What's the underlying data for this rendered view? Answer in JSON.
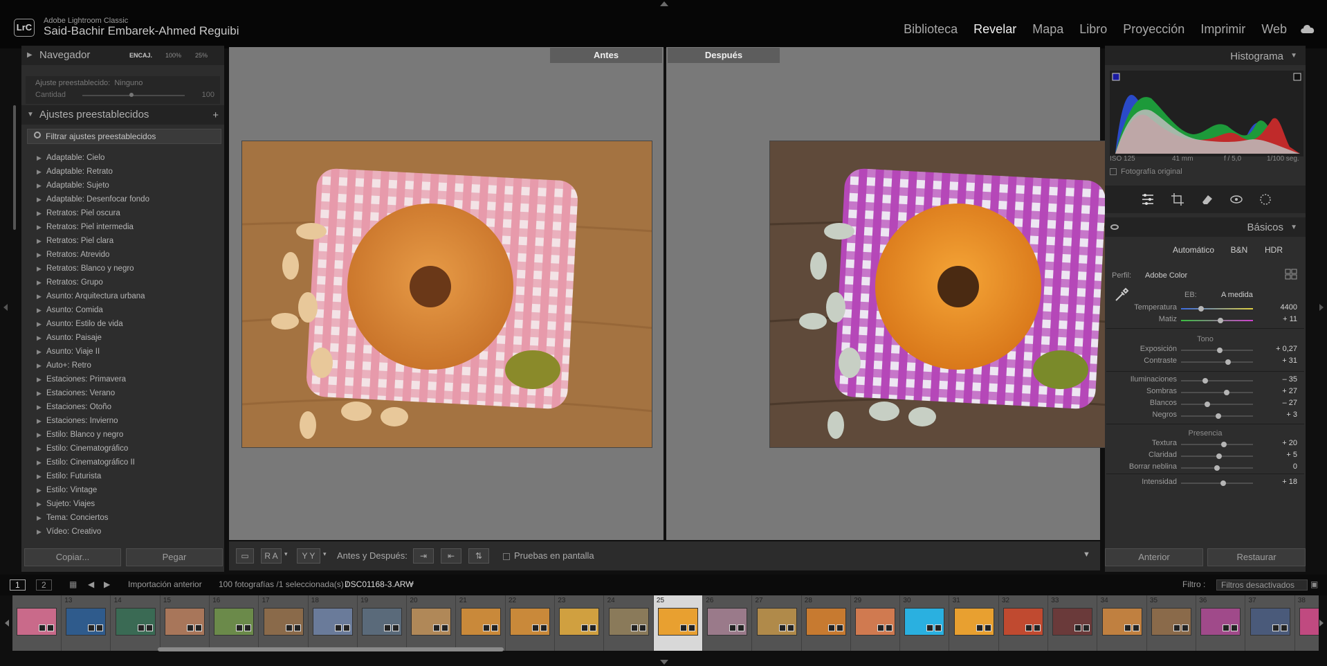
{
  "app": {
    "product": "Adobe Lightroom Classic",
    "logo": "LrC",
    "user": "Said-Bachir Embarek-Ahmed Reguibi"
  },
  "modules": [
    "Biblioteca",
    "Revelar",
    "Mapa",
    "Libro",
    "Proyección",
    "Imprimir",
    "Web"
  ],
  "active_module": "Revelar",
  "left": {
    "navigator": {
      "title": "Navegador",
      "zoom_fit": "ENCAJ.",
      "zoom_100": "100%",
      "zoom_25": "25%"
    },
    "preset_box": {
      "label": "Ajuste preestablecido:",
      "value": "Ninguno",
      "amount_label": "Cantidad",
      "amount_value": "100",
      "amount_fraction": 0.8
    },
    "presets": {
      "title": "Ajustes preestablecidos",
      "filter_placeholder": "Filtrar ajustes preestablecidos",
      "items": [
        "Adaptable: Cielo",
        "Adaptable: Retrato",
        "Adaptable: Sujeto",
        "Adaptable: Desenfocar fondo",
        "Retratos: Piel oscura",
        "Retratos: Piel intermedia",
        "Retratos: Piel clara",
        "Retratos: Atrevido",
        "Retratos: Blanco y negro",
        "Retratos: Grupo",
        "Asunto: Arquitectura urbana",
        "Asunto: Comida",
        "Asunto: Estilo de vida",
        "Asunto: Paisaje",
        "Asunto: Viaje II",
        "Auto+: Retro",
        "Estaciones: Primavera",
        "Estaciones: Verano",
        "Estaciones: Otoño",
        "Estaciones: Invierno",
        "Estilo: Blanco y negro",
        "Estilo: Cinematográfico",
        "Estilo: Cinematográfico II",
        "Estilo: Futurista",
        "Estilo: Vintage",
        "Sujeto: Viajes",
        "Tema: Conciertos",
        "Vídeo: Creativo"
      ]
    },
    "buttons": {
      "copy": "Copiar...",
      "paste": "Pegar"
    }
  },
  "center": {
    "before_label": "Antes",
    "after_label": "Después"
  },
  "toolbar": {
    "mode_ra": "R A",
    "mode_yy": "Y Y",
    "before_after": "Antes y Después:",
    "proof": "Pruebas en pantalla"
  },
  "right": {
    "histogram": {
      "title": "Histograma",
      "iso": "ISO 125",
      "focal": "41 mm",
      "aperture": "f / 5,0",
      "shutter": "1/100 seg.",
      "original": "Fotografía original"
    },
    "basic": {
      "title": "Básicos",
      "treatments": [
        "Automático",
        "B&N",
        "HDR"
      ],
      "profile_label": "Perfil:",
      "profile_value": "Adobe Color",
      "wb_label": "EB:",
      "wb_value": "A medida",
      "wb_sliders": [
        {
          "label": "Temperatura",
          "value": "4400",
          "pos": 0.28
        },
        {
          "label": "Matiz",
          "value": "+ 11",
          "pos": 0.55
        }
      ],
      "tone_label": "Tono",
      "tone_sliders": [
        {
          "label": "Exposición",
          "value": "+ 0,27",
          "pos": 0.54
        },
        {
          "label": "Contraste",
          "value": "+ 31",
          "pos": 0.65
        }
      ],
      "tone2_sliders": [
        {
          "label": "Iluminaciones",
          "value": "– 35",
          "pos": 0.34
        },
        {
          "label": "Sombras",
          "value": "+ 27",
          "pos": 0.63
        },
        {
          "label": "Blancos",
          "value": "– 27",
          "pos": 0.37
        },
        {
          "label": "Negros",
          "value": "+ 3",
          "pos": 0.52
        }
      ],
      "presence_label": "Presencia",
      "presence_sliders": [
        {
          "label": "Textura",
          "value": "+ 20",
          "pos": 0.6
        },
        {
          "label": "Claridad",
          "value": "+ 5",
          "pos": 0.53
        },
        {
          "label": "Borrar neblina",
          "value": "0",
          "pos": 0.5
        }
      ],
      "vib_sliders": [
        {
          "label": "Intensidad",
          "value": "+ 18",
          "pos": 0.59
        }
      ]
    },
    "buttons": {
      "previous": "Anterior",
      "reset": "Restaurar"
    }
  },
  "filmbar": {
    "view1": "1",
    "view2": "2",
    "source": "Importación anterior",
    "count": "100 fotografías /1 seleccionada(s) /",
    "file": "DSC01168-3.ARW",
    "filter_label": "Filtro :",
    "filter_value": "Filtros desactivados"
  },
  "filmstrip": {
    "numbers": [
      "",
      "13",
      "14",
      "15",
      "16",
      "17",
      "18",
      "19",
      "20",
      "21",
      "22",
      "23",
      "24",
      "25",
      "26",
      "27",
      "28",
      "29",
      "30",
      "31",
      "32",
      "33",
      "34",
      "35",
      "36",
      "37",
      "38"
    ],
    "selected": "25",
    "thumb_colors": [
      "#c96a8a",
      "#2f5b8c",
      "#3a6a54",
      "#a8765a",
      "#6b8a4a",
      "#8a6a4a",
      "#6a7b9a",
      "#5a6a7a",
      "#b08858",
      "#c9893a",
      "#c9893a",
      "#d0a040",
      "#8a7a5a",
      "#e8a030",
      "#9a7a8a",
      "#b08a4a",
      "#c77a30",
      "#d07a50",
      "#2ab0e0",
      "#e8a030",
      "#c04a30",
      "#6a3a3a",
      "#c08040",
      "#8a6a4a",
      "#a04a8a",
      "#4a5a7a",
      "#c04a80"
    ]
  }
}
